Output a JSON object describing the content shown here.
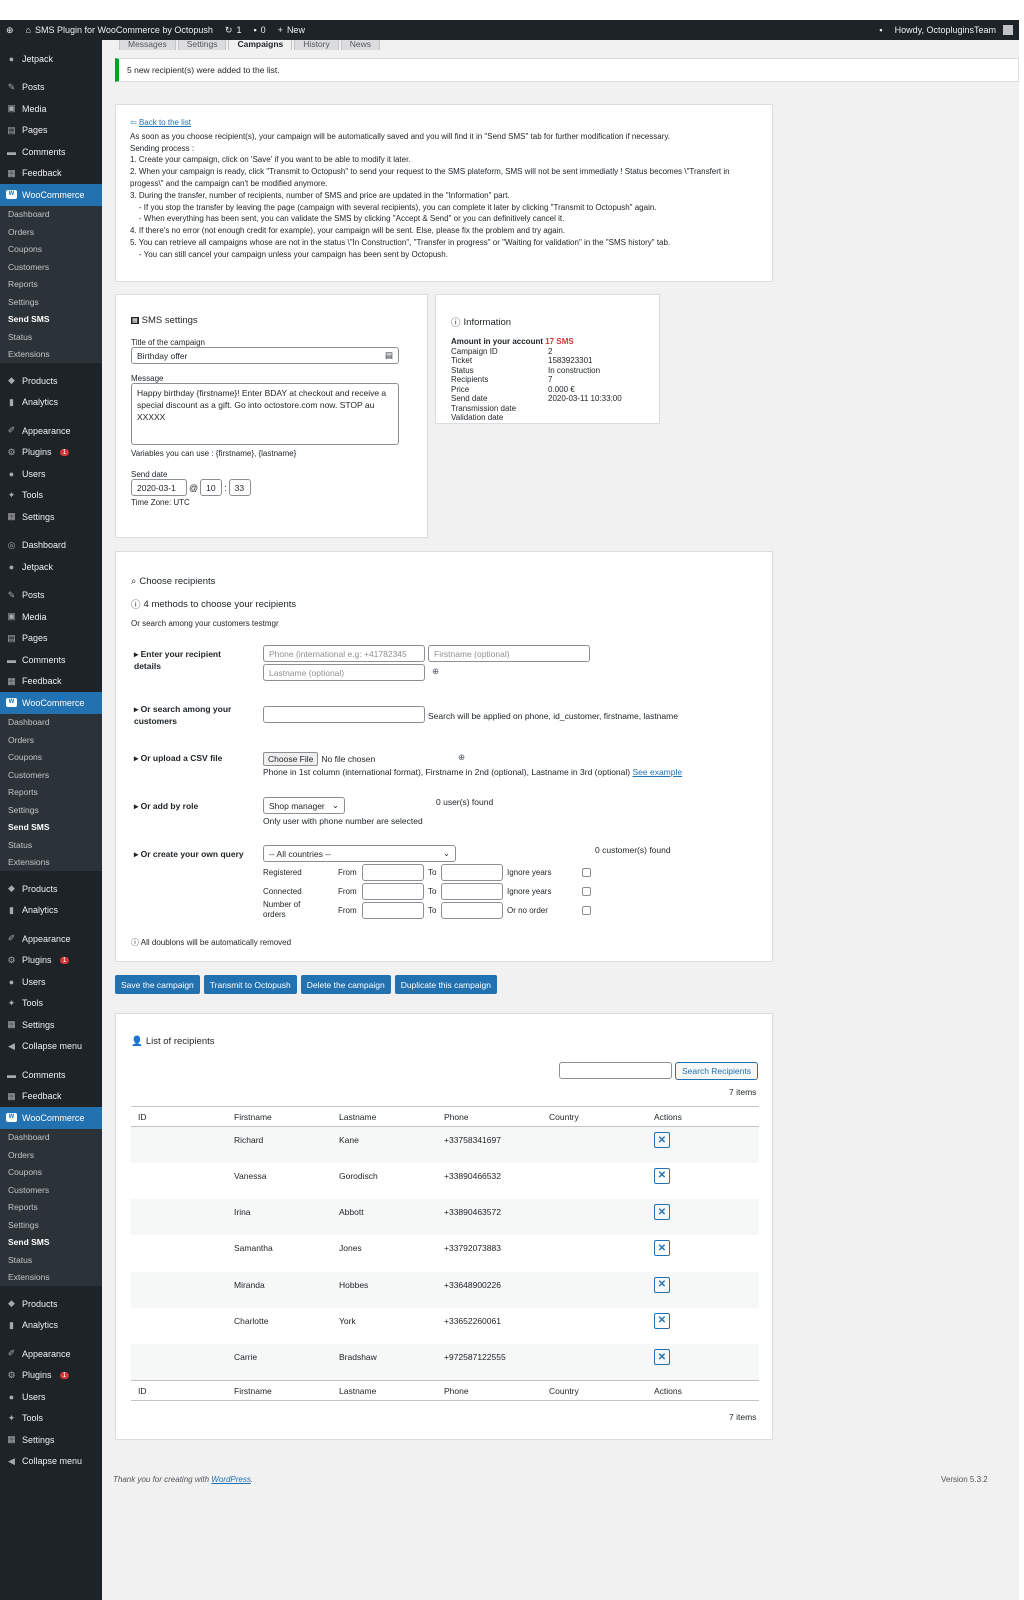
{
  "adminbar": {
    "wp_icon": "wordpress-icon",
    "site_title": "SMS Plugin for WooCommerce by Octopush",
    "updates": "1",
    "comments": "0",
    "new_label": "New",
    "howdy": "Howdy, OctopluginsTeam"
  },
  "sidebar": {
    "groups": [
      [
        {
          "label": "Jetpack",
          "icon": "jetpack-icon"
        },
        {
          "label": "Posts",
          "icon": "pin-icon",
          "gap": true
        },
        {
          "label": "Media",
          "icon": "media-icon"
        },
        {
          "label": "Pages",
          "icon": "pages-icon"
        },
        {
          "label": "Comments",
          "icon": "comments-icon"
        },
        {
          "label": "Feedback",
          "icon": "feedback-icon"
        },
        {
          "label": "WooCommerce",
          "icon": "woocommerce-icon",
          "wc": true
        },
        {
          "label": "Dashboard",
          "sub": true
        },
        {
          "label": "Orders",
          "sub": true
        },
        {
          "label": "Coupons",
          "sub": true
        },
        {
          "label": "Customers",
          "sub": true
        },
        {
          "label": "Reports",
          "sub": true
        },
        {
          "label": "Settings",
          "sub": true
        },
        {
          "label": "Send SMS",
          "sub": true,
          "cur": true
        },
        {
          "label": "Status",
          "sub": true
        },
        {
          "label": "Extensions",
          "sub": true
        },
        {
          "label": "Products",
          "icon": "products-icon",
          "gap": true
        },
        {
          "label": "Analytics",
          "icon": "analytics-icon"
        },
        {
          "label": "Appearance",
          "icon": "appearance-icon",
          "gap": true
        },
        {
          "label": "Plugins",
          "icon": "plugins-icon",
          "badge": "1"
        },
        {
          "label": "Users",
          "icon": "users-icon"
        },
        {
          "label": "Tools",
          "icon": "tools-icon"
        },
        {
          "label": "Settings",
          "icon": "settings-icon"
        },
        {
          "label": "Dashboard",
          "icon": "dashboard-icon",
          "gap": true
        },
        {
          "label": "Jetpack",
          "icon": "jetpack-icon"
        },
        {
          "label": "Posts",
          "icon": "pin-icon",
          "gap": true
        },
        {
          "label": "Media",
          "icon": "media-icon"
        },
        {
          "label": "Pages",
          "icon": "pages-icon"
        },
        {
          "label": "Comments",
          "icon": "comments-icon"
        },
        {
          "label": "Feedback",
          "icon": "feedback-icon"
        },
        {
          "label": "WooCommerce",
          "icon": "woocommerce-icon",
          "wc": true
        },
        {
          "label": "Dashboard",
          "sub": true
        },
        {
          "label": "Orders",
          "sub": true
        },
        {
          "label": "Coupons",
          "sub": true
        },
        {
          "label": "Customers",
          "sub": true
        },
        {
          "label": "Reports",
          "sub": true
        },
        {
          "label": "Settings",
          "sub": true
        },
        {
          "label": "Send SMS",
          "sub": true,
          "cur": true
        },
        {
          "label": "Status",
          "sub": true
        },
        {
          "label": "Extensions",
          "sub": true
        },
        {
          "label": "Products",
          "icon": "products-icon",
          "gap": true
        },
        {
          "label": "Analytics",
          "icon": "analytics-icon"
        },
        {
          "label": "Appearance",
          "icon": "appearance-icon",
          "gap": true
        },
        {
          "label": "Plugins",
          "icon": "plugins-icon",
          "badge": "1"
        },
        {
          "label": "Users",
          "icon": "users-icon"
        },
        {
          "label": "Tools",
          "icon": "tools-icon"
        },
        {
          "label": "Settings",
          "icon": "settings-icon"
        },
        {
          "label": "Collapse menu",
          "icon": "collapse-icon"
        },
        {
          "label": "Comments",
          "icon": "comments-icon",
          "gap": true
        },
        {
          "label": "Feedback",
          "icon": "feedback-icon"
        },
        {
          "label": "WooCommerce",
          "icon": "woocommerce-icon",
          "wc": true
        },
        {
          "label": "Dashboard",
          "sub": true
        },
        {
          "label": "Orders",
          "sub": true
        },
        {
          "label": "Coupons",
          "sub": true
        },
        {
          "label": "Customers",
          "sub": true
        },
        {
          "label": "Reports",
          "sub": true
        },
        {
          "label": "Settings",
          "sub": true
        },
        {
          "label": "Send SMS",
          "sub": true,
          "cur": true
        },
        {
          "label": "Status",
          "sub": true
        },
        {
          "label": "Extensions",
          "sub": true
        },
        {
          "label": "Products",
          "icon": "products-icon",
          "gap": true
        },
        {
          "label": "Analytics",
          "icon": "analytics-icon"
        },
        {
          "label": "Appearance",
          "icon": "appearance-icon",
          "gap": true
        },
        {
          "label": "Plugins",
          "icon": "plugins-icon",
          "badge": "1"
        },
        {
          "label": "Users",
          "icon": "users-icon"
        },
        {
          "label": "Tools",
          "icon": "tools-icon"
        },
        {
          "label": "Settings",
          "icon": "settings-icon"
        },
        {
          "label": "Collapse menu",
          "icon": "collapse-icon"
        }
      ]
    ]
  },
  "tabs": [
    "Messages",
    "Settings",
    "Campaigns",
    "History",
    "News"
  ],
  "notice": "5 new recipient(s) were added to the list.",
  "intro": {
    "back": "Back to the list",
    "lines": [
      "As soon as you choose recipient(s), your campaign will be automatically saved and you will find it in \"Send SMS\" tab for further modification if necessary.",
      "Sending process :",
      "1. Create your campaign, click on 'Save' if you want to be able to modify it later.",
      "2. When your campaign is ready, click \"Transmit to Octopush\" to send your request to the SMS plateform, SMS will not be sent immediatly ! Status becomes \\\"Transfert in progess\\\" and the campaign can't be modified anymore.",
      "3. During the transfer, number of recipients, number of SMS and price are updated in the \"Information\" part.",
      "    - If you stop the transfer by leaving the page (campaign with several recipients), you can complete it later by clicking \"Transmit to Octopush\" again.",
      "    - When everything has been sent, you can validate the SMS by clicking \"Accept & Send\" or you can definitively cancel it.",
      "4. If there's no error (not enough credit for example), your campaign will be sent. Else, please fix the problem and try again.",
      "5. You can retrieve all campaigns whose are not in the status \\\"In Construction\", \"Transfer in progress\" or \"Waiting for validation\" in the \"SMS history\" tab.",
      "    - You can still cancel your campaign unless your campaign has been sent by Octopush."
    ]
  },
  "sms": {
    "title": "SMS settings",
    "title_label": "Title of the campaign",
    "title_value": "Birthday offer",
    "message_label": "Message",
    "message": "Happy birthday {firstname}! Enter BDAY at checkout and receive a special discount as a gift. Go into octostore.com now. STOP au XXXXX",
    "variables": "Variables you can use : {firstname}, {lastname}",
    "send_label": "Send date",
    "date": "2020-03-1",
    "at": "@",
    "hour": "10",
    "colon": ":",
    "minute": "33",
    "tz": "Time Zone: UTC"
  },
  "info": {
    "title": "Information",
    "amount_label": "Amount in your account",
    "amount": "17 SMS",
    "rows": [
      [
        "Campaign ID",
        "2"
      ],
      [
        "Ticket",
        "1583923301"
      ],
      [
        "Status",
        "In construction"
      ],
      [
        "Recipients",
        "7"
      ],
      [
        "Price",
        "0.000 €"
      ],
      [
        "Send date",
        "2020-03-11 10:33:00"
      ],
      [
        "Transmission date",
        ""
      ],
      [
        "Validation date",
        ""
      ]
    ]
  },
  "recip": {
    "title": "Choose recipients",
    "methods": "4 methods to choose your recipients",
    "search_hint": "Or search among your customers testmgr",
    "m1": "Enter your recipient details",
    "phone_ph": "Phone (international e.g: +41782345",
    "first_ph": "Firstname (optional)",
    "last_ph": "Lastname (optional)",
    "m2": "Or search among your customers",
    "m2_hint": "Search will be applied on phone, id_customer, firstname, lastname",
    "m3": "Or upload a CSV file",
    "choose": "Choose File",
    "nofile": "No file chosen",
    "m3_hint": "Phone in 1st column (international format), Firstname in 2nd (optional), Lastname in 3rd (optional)",
    "see": "See example",
    "m4": "Or add by role",
    "role": "Shop manager",
    "m4_found": "0 user(s) found",
    "m4_hint": "Only user with phone number are selected",
    "m5": "Or create your own query",
    "countries": "-- All countries --",
    "m5_found": "0 customer(s) found",
    "q1": "Registered",
    "q2": "Connected",
    "q3": "Number of orders",
    "from": "From",
    "to": "To",
    "ign": "Ignore years",
    "noorder": "Or no order",
    "doub": "All doublons will be automatically removed"
  },
  "buttons": [
    "Save the campaign",
    "Transmit to Octopush",
    "Delete the campaign",
    "Duplicate this campaign"
  ],
  "list": {
    "title": "List of recipients",
    "search_btn": "Search Recipients",
    "count": "7 items",
    "cols": [
      "ID",
      "Firstname",
      "Lastname",
      "Phone",
      "Country",
      "Actions"
    ],
    "rows": [
      [
        "",
        "Richard",
        "Kane",
        "+33758341697",
        ""
      ],
      [
        "",
        "Vanessa",
        "Gorodisch",
        "+33890466532",
        ""
      ],
      [
        "",
        "Irina",
        "Abbott",
        "+33890463572",
        ""
      ],
      [
        "",
        "Samantha",
        "Jones",
        "+33792073883",
        ""
      ],
      [
        "",
        "Miranda",
        "Hobbes",
        "+33648900226",
        ""
      ],
      [
        "",
        "Charlotte",
        "York",
        "+33652260061",
        ""
      ],
      [
        "",
        "Carrie",
        "Bradshaw",
        "+972587122555",
        ""
      ]
    ]
  },
  "footer": {
    "thanks": "Thank you for creating with ",
    "wp": "WordPress",
    "dot": ".",
    "version": "Version 5.3.2"
  }
}
